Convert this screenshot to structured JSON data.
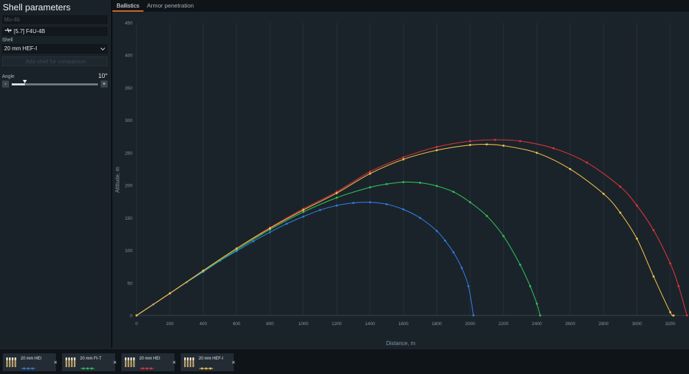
{
  "sidebar": {
    "title": "Shell parameters",
    "search_placeholder": "Mu-4b",
    "aircraft": "[5.7] F4U-4B",
    "shell_label": "Shell",
    "shell_selected": "20 mm HEF-I",
    "add_shell": "Add shell for comparison",
    "angle_label": "Angle",
    "angle_value": "10°",
    "angle_minus": "-",
    "angle_plus": "+"
  },
  "tabs": [
    {
      "label": "Ballistics",
      "active": true
    },
    {
      "label": "Armor penetration",
      "active": false
    }
  ],
  "colors": {
    "accent": "#d26a2c",
    "blue": "#2f7de0",
    "green": "#2ec05a",
    "red": "#e0353a",
    "yellow": "#f2c14b"
  },
  "chart_data": {
    "type": "line",
    "xlabel": "Distance, m",
    "ylabel": "Altitude, m",
    "xlim": [
      0,
      3300
    ],
    "ylim": [
      0,
      450
    ],
    "xticks": [
      0,
      200,
      400,
      600,
      800,
      1000,
      1200,
      1400,
      1600,
      1800,
      2000,
      2200,
      2400,
      2600,
      2800,
      3000,
      3200
    ],
    "yticks": [
      0,
      50,
      100,
      150,
      200,
      250,
      300,
      350,
      400,
      450
    ],
    "grid": "vertical",
    "series": [
      {
        "color": "blue",
        "x": [
          0,
          100,
          200,
          300,
          400,
          500,
          600,
          700,
          800,
          900,
          1000,
          1100,
          1200,
          1300,
          1400,
          1500,
          1600,
          1700,
          1800,
          1850,
          1900,
          1950,
          1990,
          2020
        ],
        "y": [
          0,
          17,
          34,
          51,
          67,
          84,
          99,
          114,
          128,
          141,
          152,
          162,
          169,
          173,
          174,
          171,
          163,
          150,
          130,
          115,
          97,
          73,
          45,
          0
        ]
      },
      {
        "color": "green",
        "x": [
          0,
          200,
          400,
          600,
          800,
          1000,
          1200,
          1400,
          1500,
          1600,
          1700,
          1800,
          1900,
          2000,
          2100,
          2200,
          2300,
          2360,
          2400,
          2420
        ],
        "y": [
          0,
          34,
          68,
          101,
          132,
          159,
          181,
          197,
          202,
          205,
          204,
          199,
          190,
          174,
          153,
          122,
          78,
          45,
          18,
          0
        ]
      },
      {
        "color": "red",
        "x": [
          0,
          200,
          400,
          600,
          800,
          1000,
          1200,
          1400,
          1600,
          1800,
          2000,
          2150,
          2300,
          2500,
          2700,
          2900,
          3000,
          3100,
          3200,
          3250,
          3300
        ],
        "y": [
          0,
          34,
          69,
          103,
          135,
          164,
          190,
          221,
          243,
          259,
          268,
          270,
          268,
          257,
          235,
          198,
          169,
          131,
          80,
          45,
          0
        ]
      },
      {
        "color": "yellow",
        "x": [
          0,
          200,
          400,
          600,
          800,
          1000,
          1200,
          1400,
          1600,
          1800,
          2000,
          2100,
          2200,
          2400,
          2600,
          2800,
          2900,
          3000,
          3100,
          3200,
          3220
        ],
        "y": [
          0,
          34,
          69,
          103,
          134,
          162,
          188,
          218,
          240,
          254,
          262,
          263,
          261,
          250,
          225,
          187,
          158,
          118,
          60,
          5,
          0
        ]
      }
    ]
  },
  "comparison": [
    {
      "name": "20 mm HEI",
      "color": "blue"
    },
    {
      "name": "20 mm FI-T",
      "color": "green"
    },
    {
      "name": "20 mm HEI",
      "color": "red"
    },
    {
      "name": "20 mm HEF-I",
      "color": "yellow"
    }
  ],
  "close_glyph": "×"
}
